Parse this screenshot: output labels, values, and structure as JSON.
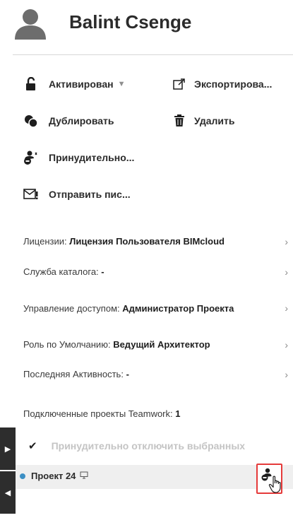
{
  "user": {
    "name": "Balint Csenge"
  },
  "actions": {
    "activated": "Активирован",
    "export": "Экспортирова...",
    "duplicate": "Дублировать",
    "delete": "Удалить",
    "force": "Принудительно...",
    "send_mail": "Отправить пис..."
  },
  "properties": {
    "license_label": "Лицензии:",
    "license_value": "Лицензия Пользователя BIMcloud",
    "catalog_label": "Служба каталога:",
    "catalog_value": "-",
    "access_label": "Управление доступом:",
    "access_value": "Администратор Проекта",
    "role_label": "Роль по Умолчанию:",
    "role_value": "Ведущий Архитектор",
    "activity_label": "Последняя Активность:",
    "activity_value": "-"
  },
  "teamwork": {
    "label": "Подключенные проекты Teamwork:",
    "count": "1",
    "force_disconnect": "Принудительно отключить выбранных",
    "project_name": "Проект 24"
  },
  "icons": {
    "avatar": "user-avatar-icon",
    "unlock": "unlock-icon",
    "export": "export-icon",
    "duplicate": "duplicate-icon",
    "delete": "trash-icon",
    "force": "force-disconnect-icon",
    "mail": "mail-icon",
    "monitor": "monitor-icon",
    "user_disconnect": "user-disconnect-icon",
    "cursor": "hand-cursor-icon"
  },
  "colors": {
    "accent_dot": "#3c8fc4",
    "highlight": "#e53a3a",
    "tab_bg": "#2d2d2d"
  }
}
